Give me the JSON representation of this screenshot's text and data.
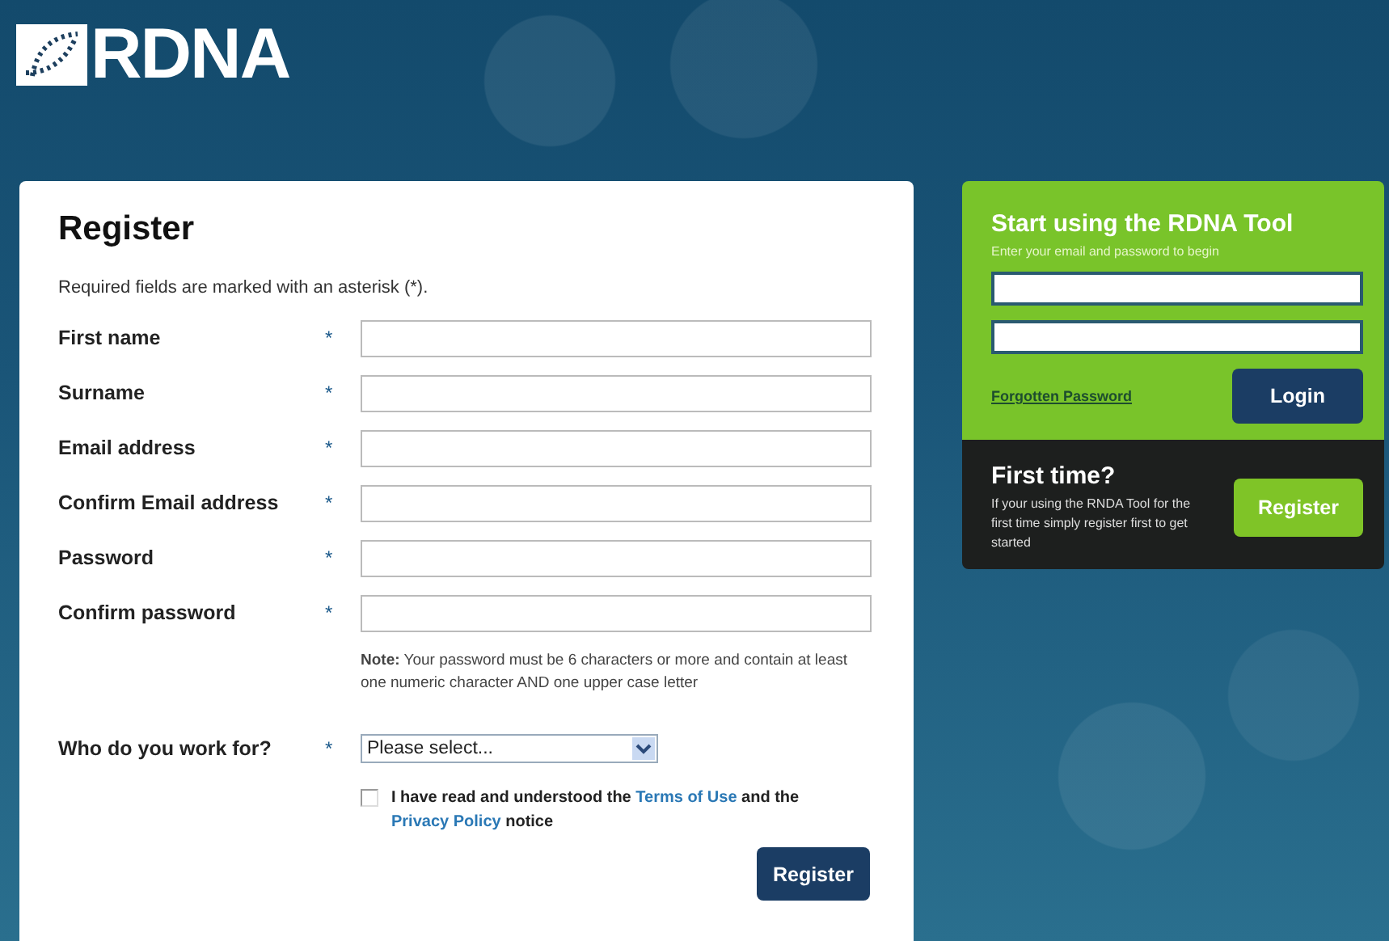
{
  "logo": {
    "text": "RDNA"
  },
  "register_form": {
    "title": "Register",
    "intro": "Required fields are marked with an asterisk (*).",
    "fields": [
      {
        "label": "First name",
        "required_mark": "*",
        "kind": "text"
      },
      {
        "label": "Surname",
        "required_mark": "*",
        "kind": "text"
      },
      {
        "label": "Email address",
        "required_mark": "*",
        "kind": "text"
      },
      {
        "label": "Confirm Email address",
        "required_mark": "*",
        "kind": "text"
      },
      {
        "label": "Password",
        "required_mark": "*",
        "kind": "text"
      },
      {
        "label": "Confirm password",
        "required_mark": "*",
        "kind": "text"
      }
    ],
    "note": "**Note:** Your password must be 6 characters or more and contain at least one numeric character AND one upper case letter",
    "employer": {
      "label": "Who do you work for?",
      "required_mark": "*",
      "value": "Please select..."
    },
    "agreement": {
      "checked": false,
      "text_before": "I have read and understood the",
      "terms_link": "Terms of Use",
      "text_middle": "and the",
      "privacy_link": "Privacy Policy",
      "text_after": "notice"
    },
    "submit_button": "Register"
  },
  "login_panel": {
    "title": "Start using the RDNA Tool",
    "subtitle": "Enter your email and password to begin",
    "forgot_link": "Forgotten Password",
    "login_button": "Login"
  },
  "first_time": {
    "title": "First time?",
    "text": "If your using the RNDA Tool for the first time simply register first to get started",
    "register_button": "Register"
  }
}
